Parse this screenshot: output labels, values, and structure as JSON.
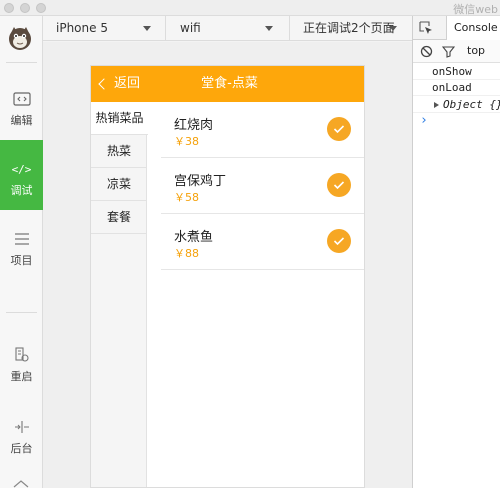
{
  "window": {
    "title": "微信web"
  },
  "sidebar": {
    "items": [
      {
        "label": "编辑",
        "icon": "code-editor-icon",
        "active": false
      },
      {
        "label": "调试",
        "icon": "debug-code-icon",
        "active": true
      },
      {
        "label": "项目",
        "icon": "menu-list-icon",
        "active": false
      },
      {
        "label": "重启",
        "icon": "restart-icon",
        "active": false
      },
      {
        "label": "后台",
        "icon": "background-icon",
        "active": false
      }
    ]
  },
  "toolbar": {
    "device": "iPhone 5",
    "network": "wifi",
    "status": "正在调试2个页面"
  },
  "app": {
    "nav": {
      "back_label": "返回",
      "title": "堂食-点菜"
    },
    "categories": [
      "热销菜品",
      "热菜",
      "凉菜",
      "套餐"
    ],
    "dishes": [
      {
        "name": "红烧肉",
        "price": "￥38",
        "checked": true
      },
      {
        "name": "宫保鸡丁",
        "price": "￥58",
        "checked": true
      },
      {
        "name": "水煮鱼",
        "price": "￥88",
        "checked": true
      }
    ]
  },
  "devtools": {
    "tab": "Console",
    "filter": "top",
    "logs": [
      "onShow",
      "onLoad",
      "Object {}"
    ],
    "prompt": "›"
  },
  "colors": {
    "accent": "#fea70b",
    "active_sidebar": "#45b842"
  }
}
